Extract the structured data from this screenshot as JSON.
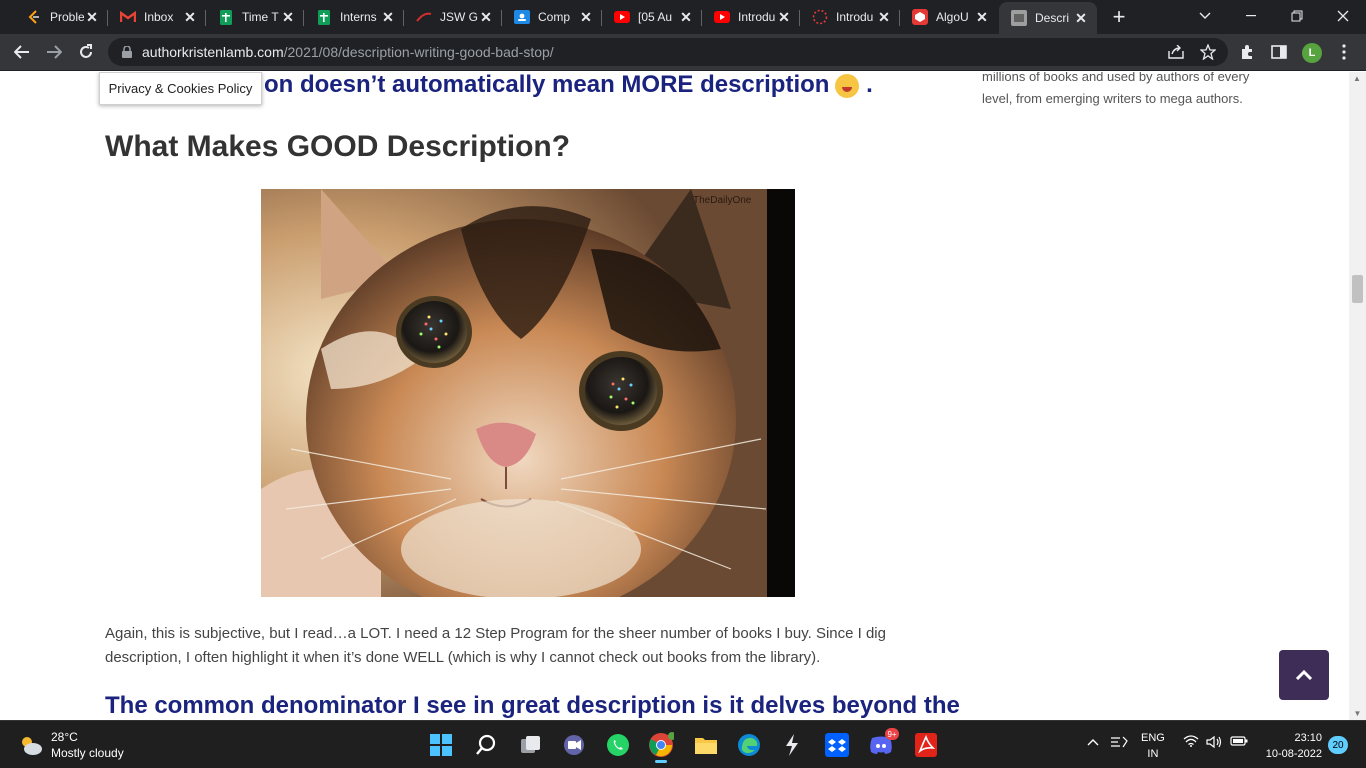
{
  "browser": {
    "tabs": [
      {
        "title": "Proble",
        "icon": "leetcode-icon",
        "color": "#ffa116"
      },
      {
        "title": "Inbox",
        "icon": "gmail-icon",
        "color": "#ea4335"
      },
      {
        "title": "Time T",
        "icon": "sheets-icon",
        "color": "#0f9d58"
      },
      {
        "title": "Interns",
        "icon": "sheets-icon",
        "color": "#0f9d58"
      },
      {
        "title": "JSW G",
        "icon": "jsw-icon",
        "color": "#d32f2f"
      },
      {
        "title": "Comp",
        "icon": "classroom-icon",
        "color": "#1e88e5"
      },
      {
        "title": "[05 Au",
        "icon": "youtube-icon",
        "color": "#ff0000"
      },
      {
        "title": "Introdu",
        "icon": "youtube-icon",
        "color": "#ff0000"
      },
      {
        "title": "Introdu",
        "icon": "loading-icon",
        "color": "#e53935"
      },
      {
        "title": "AlgoU",
        "icon": "algouniversity-icon",
        "color": "#e53935"
      },
      {
        "title": "Descri",
        "icon": "site-favicon",
        "color": "#9e9e9e",
        "active": true
      }
    ],
    "address": {
      "host": "authorkristenlamb.com",
      "path": "/2021/08/description-writing-good-bad-stop/"
    },
    "profile_initial": "L"
  },
  "page": {
    "cookie_badge": "Privacy & Cookies Policy",
    "heading_partial": "on doesn’t automatically mean MORE description",
    "heading_partial_suffix": ".",
    "h2": "What Makes GOOD Description?",
    "image_watermark": "TheDailyOne",
    "paragraph": "Again, this is subjective, but I read…a LOT. I need a 12 Step Program for the sheer number of books I buy. Since I dig description, I often highlight it when it’s done WELL (which is why I cannot check out books from the library).",
    "h3": "The common denominator I see in great description is it delves beyond the",
    "sidebar_text": "millions of books and used by authors of every level, from emerging writers to mega authors.",
    "accent_color": "#1a237e",
    "totop_color": "#3d2d57"
  },
  "taskbar": {
    "weather_temp": "28°C",
    "weather_desc": "Mostly cloudy",
    "discord_badge": "9+",
    "lang_line1": "ENG",
    "lang_line2": "IN",
    "time": "23:10",
    "date": "10-08-2022",
    "notifications": "20"
  }
}
